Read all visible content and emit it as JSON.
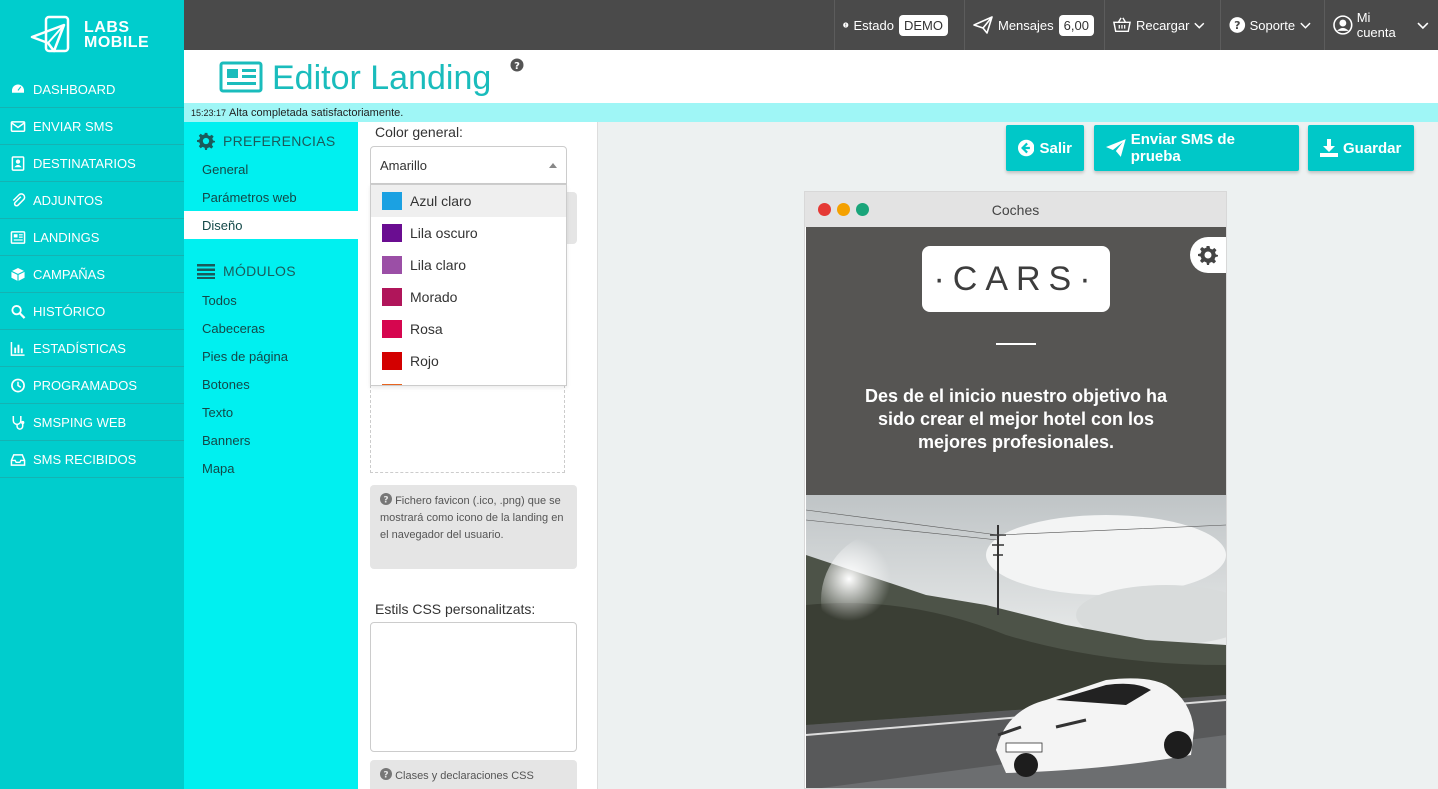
{
  "brand": {
    "line1": "LABS",
    "line2": "MOBILE"
  },
  "nav": [
    {
      "label": "DASHBOARD",
      "icon": "dashboard-icon"
    },
    {
      "label": "ENVIAR SMS",
      "icon": "envelope-icon"
    },
    {
      "label": "DESTINATARIOS",
      "icon": "contacts-icon"
    },
    {
      "label": "ADJUNTOS",
      "icon": "paperclip-icon"
    },
    {
      "label": "LANDINGS",
      "icon": "newspaper-icon"
    },
    {
      "label": "CAMPAÑAS",
      "icon": "cube-icon"
    },
    {
      "label": "HISTÓRICO",
      "icon": "search-icon"
    },
    {
      "label": "ESTADÍSTICAS",
      "icon": "bar-chart-icon"
    },
    {
      "label": "PROGRAMADOS",
      "icon": "clock-icon"
    },
    {
      "label": "SMSPING WEB",
      "icon": "stethoscope-icon"
    },
    {
      "label": "SMS RECIBIDOS",
      "icon": "inbox-icon"
    }
  ],
  "topbar": {
    "estado_label": "Estado",
    "estado_badge": "DEMO",
    "mensajes_label": "Mensajes",
    "mensajes_badge": "6,00",
    "recargar_label": "Recargar",
    "soporte_label": "Soporte",
    "cuenta_label": "Mi cuenta"
  },
  "header": {
    "title": "Editor Landing"
  },
  "status": {
    "time": "15:23:17",
    "message": "Alta completada satisfactoriamente."
  },
  "menu2": {
    "preferencias_label": "PREFERENCIAS",
    "pref_items": [
      "General",
      "Parámetros web",
      "Diseño"
    ],
    "modulos_label": "MÓDULOS",
    "mod_items": [
      "Todos",
      "Cabeceras",
      "Pies de página",
      "Botones",
      "Texto",
      "Banners",
      "Mapa"
    ]
  },
  "form": {
    "color_label": "Color general:",
    "selected": "Amarillo",
    "options": [
      {
        "label": "Azul claro",
        "color": "#1ba1e2"
      },
      {
        "label": "Lila oscuro",
        "color": "#6a0d91"
      },
      {
        "label": "Lila claro",
        "color": "#9b4fa6"
      },
      {
        "label": "Morado",
        "color": "#b0155a"
      },
      {
        "label": "Rosa",
        "color": "#d6064f"
      },
      {
        "label": "Rojo",
        "color": "#d30000"
      }
    ],
    "favicon_help": "Fichero favicon (.ico, .png) que se mostrará como icono de la landing en el navegador del usuario.",
    "css_label": "Estils CSS personalitzats:",
    "css_help": "Clases y declaraciones CSS"
  },
  "actions": {
    "salir": "Salir",
    "enviar": "Enviar SMS de prueba",
    "guardar": "Guardar"
  },
  "preview": {
    "window_title": "Coches",
    "logo_text": "·CARS·",
    "hero_text": "Des de el inicio nuestro objetivo ha sido crear el mejor hotel con los mejores profesionales."
  },
  "colors": {
    "accent": "#00cdcd",
    "menu2_bg": "#00f0f0",
    "topbar_bg": "#4a4a4a",
    "title": "#1abcbc",
    "status_bg": "#9ff6f6"
  }
}
